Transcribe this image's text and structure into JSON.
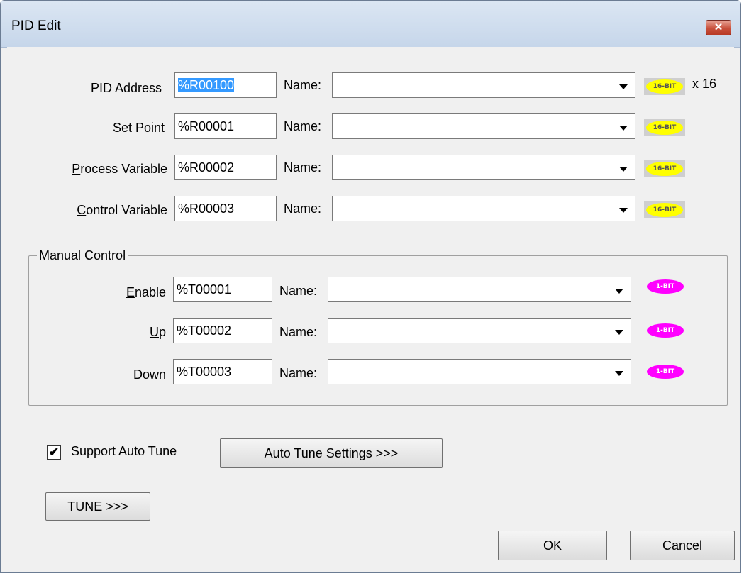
{
  "window": {
    "title": "PID Edit",
    "close_label": "✕"
  },
  "rows": [
    {
      "label_pre": "PID Address",
      "label_u": "",
      "label_post": "",
      "address": "%R00100",
      "selected": true,
      "name_label": "Name:",
      "name_value": "",
      "badge": "16-BIT",
      "suffix": "x 16"
    },
    {
      "label_pre": "",
      "label_u": "S",
      "label_post": "et Point",
      "address": "%R00001",
      "selected": false,
      "name_label": "Name:",
      "name_value": "",
      "badge": "16-BIT",
      "suffix": ""
    },
    {
      "label_pre": "",
      "label_u": "P",
      "label_post": "rocess Variable",
      "address": "%R00002",
      "selected": false,
      "name_label": "Name:",
      "name_value": "",
      "badge": "16-BIT",
      "suffix": ""
    },
    {
      "label_pre": "",
      "label_u": "C",
      "label_post": "ontrol Variable",
      "address": "%R00003",
      "selected": false,
      "name_label": "Name:",
      "name_value": "",
      "badge": "16-BIT",
      "suffix": ""
    }
  ],
  "manual_control": {
    "title": "Manual Control",
    "rows": [
      {
        "label_u": "E",
        "label_post": "nable",
        "address": "%T00001",
        "name_label": "Name:",
        "name_value": "",
        "badge": "1-BIT"
      },
      {
        "label_u": "U",
        "label_post": "p",
        "address": "%T00002",
        "name_label": "Name:",
        "name_value": "",
        "badge": "1-BIT"
      },
      {
        "label_u": "D",
        "label_post": "own",
        "address": "%T00003",
        "name_label": "Name:",
        "name_value": "",
        "badge": "1-BIT"
      }
    ]
  },
  "auto_tune": {
    "checkbox_label": "Support Auto Tune",
    "checked": true,
    "check_glyph": "✔",
    "settings_button": "Auto Tune Settings >>>"
  },
  "tune_button": "TUNE >>>",
  "ok_button": "OK",
  "cancel_button": "Cancel"
}
